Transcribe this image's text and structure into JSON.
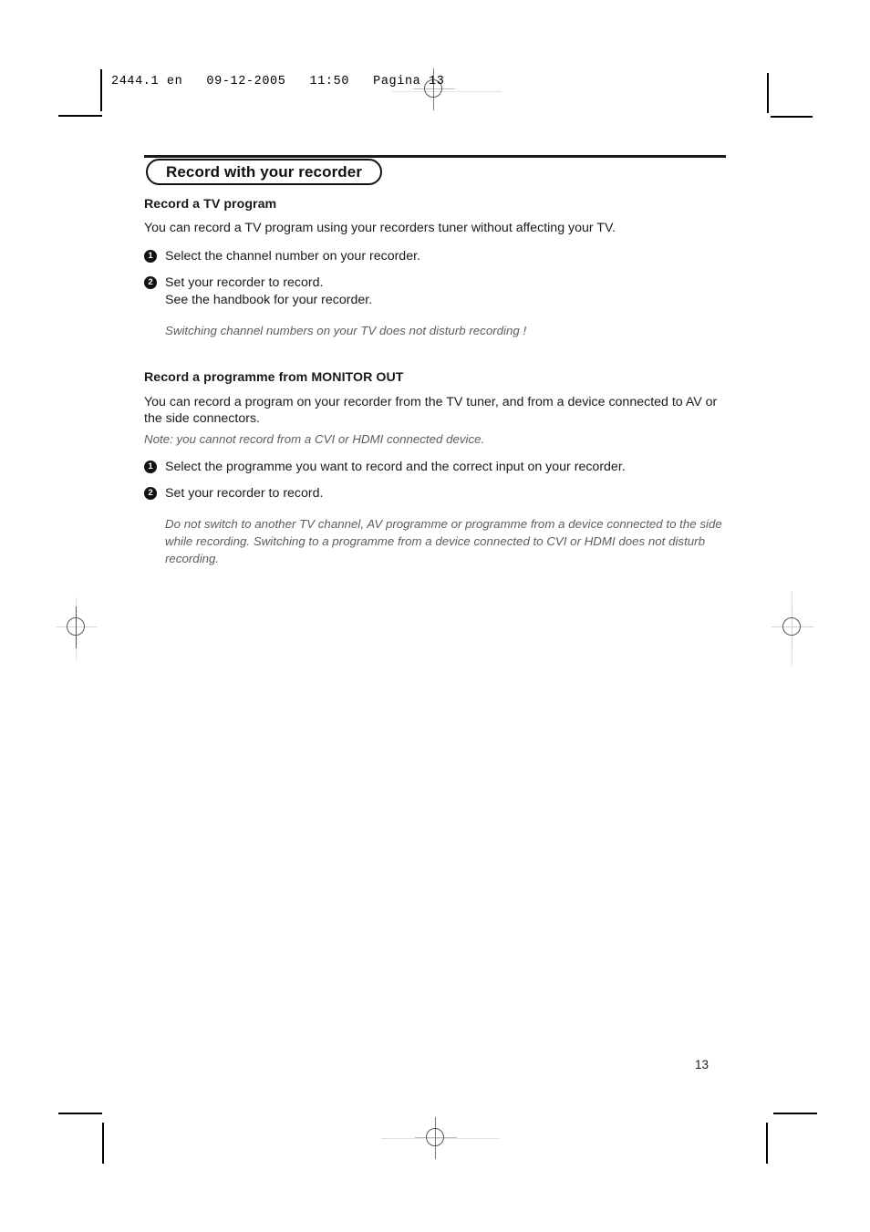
{
  "printer_slug": "2444.1 en   09-12-2005   11:50   Pagina 13",
  "chapter": {
    "title": "Record with your recorder"
  },
  "sections": [
    {
      "heading": "Record a TV program",
      "intro": "You can record a TV program using your recorders tuner without affecting your TV.",
      "steps": [
        {
          "number": "1",
          "lines": [
            "Select the channel number on your recorder."
          ]
        },
        {
          "number": "2",
          "lines": [
            "Set your recorder to record.",
            "See the handbook for your recorder."
          ]
        }
      ],
      "note": "Switching channel numbers on your TV does not disturb recording !"
    },
    {
      "heading": "Record a programme from MONITOR OUT",
      "intro": "You can record a program on your recorder from the TV tuner,  and from a device connected to AV or the side connectors.",
      "intro_note": "Note: you cannot record from a CVI or HDMI connected device.",
      "steps": [
        {
          "number": "1",
          "lines": [
            "Select the programme you want to record and the correct input on your recorder."
          ]
        },
        {
          "number": "2",
          "lines": [
            "Set your recorder to record."
          ]
        }
      ],
      "note": "Do not switch to another TV channel, AV programme or programme from a device connected to the side while recording. Switching to a programme from a device connected to CVI or HDMI does not disturb recording."
    }
  ],
  "page_number": "13",
  "colors": {
    "text": "#1a1a1a",
    "note_text": "#5d5d5d",
    "rule": "#1a1a1a",
    "registration": "#58585c",
    "page_background": "#ffffff"
  }
}
